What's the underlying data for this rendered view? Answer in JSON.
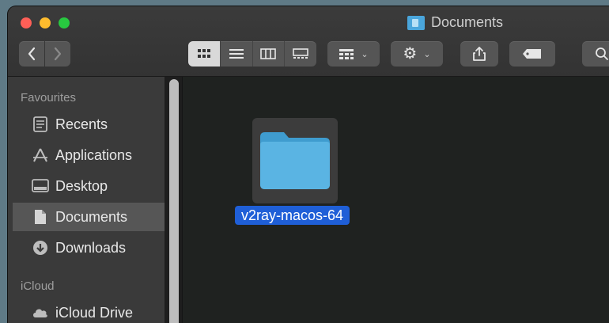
{
  "window": {
    "title": "Documents"
  },
  "toolbar": {
    "back_icon": "chevron-left-icon",
    "forward_icon": "chevron-right-icon",
    "view_modes": [
      "icon-view",
      "list-view",
      "column-view",
      "gallery-view"
    ],
    "active_view": "icon-view",
    "group_icon": "group-icon",
    "action_icon": "gear-icon",
    "share_icon": "share-icon",
    "tag_icon": "tag-icon",
    "search_icon": "search-icon"
  },
  "sidebar": {
    "sections": [
      {
        "header": "Favourites",
        "items": [
          {
            "label": "Recents",
            "icon": "recents-icon",
            "selected": false
          },
          {
            "label": "Applications",
            "icon": "applications-icon",
            "selected": false
          },
          {
            "label": "Desktop",
            "icon": "desktop-icon",
            "selected": false
          },
          {
            "label": "Documents",
            "icon": "documents-icon",
            "selected": true
          },
          {
            "label": "Downloads",
            "icon": "downloads-icon",
            "selected": false
          }
        ]
      },
      {
        "header": "iCloud",
        "items": [
          {
            "label": "iCloud Drive",
            "icon": "icloud-icon",
            "selected": false
          }
        ]
      }
    ]
  },
  "main": {
    "items": [
      {
        "name": "v2ray-macos-64",
        "type": "folder",
        "selected": true
      }
    ]
  },
  "colors": {
    "selection_blue": "#1f5fd7",
    "folder_blue": "#5ab4e3",
    "window_bg": "#1f2220",
    "sidebar_bg": "#3a3a3a",
    "toolbar_bg": "#333333"
  }
}
